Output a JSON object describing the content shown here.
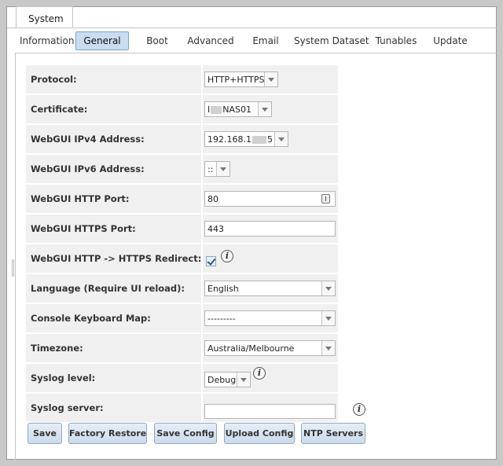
{
  "window": {
    "top_tab": "System"
  },
  "tabs": [
    {
      "label": "Information"
    },
    {
      "label": "General"
    },
    {
      "label": "Boot"
    },
    {
      "label": "Advanced"
    },
    {
      "label": "Email"
    },
    {
      "label": "System Dataset"
    },
    {
      "label": "Tunables"
    },
    {
      "label": "Update"
    }
  ],
  "form": {
    "protocol": {
      "label": "Protocol:",
      "value": "HTTP+HTTPS"
    },
    "certificate": {
      "label": "Certificate:",
      "value_prefix": "I",
      "value_suffix": "NAS01"
    },
    "ipv4": {
      "label": "WebGUI IPv4 Address:",
      "value_prefix": "192.168.1",
      "value_suffix": "5"
    },
    "ipv6": {
      "label": "WebGUI IPv6 Address:",
      "value": "::"
    },
    "http_port": {
      "label": "WebGUI HTTP Port:",
      "value": "80"
    },
    "https_port": {
      "label": "WebGUI HTTPS Port:",
      "value": "443"
    },
    "redirect": {
      "label": "WebGUI HTTP -> HTTPS Redirect:",
      "checked": true
    },
    "language": {
      "label": "Language (Require UI reload):",
      "value": "English"
    },
    "keyboard": {
      "label": "Console Keyboard Map:",
      "value": "---------"
    },
    "timezone": {
      "label": "Timezone:",
      "value": "Australia/Melbourne"
    },
    "syslog_level": {
      "label": "Syslog level:",
      "value": "Debug"
    },
    "syslog_server": {
      "label": "Syslog server:",
      "value": ""
    }
  },
  "buttons": {
    "save": "Save",
    "factory_restore": "Factory Restore",
    "save_config": "Save Config",
    "upload_config": "Upload Config",
    "ntp_servers": "NTP Servers"
  },
  "icons": {
    "info": "i",
    "info_icon": "info-icon",
    "spinner_icon": "spinner-icon",
    "dropdown_icon": "chevron-down-icon"
  },
  "colors": {
    "active_tab": "#c8ddf0",
    "button": "#d6e3f1",
    "row_bg": "#f0f0f0"
  }
}
